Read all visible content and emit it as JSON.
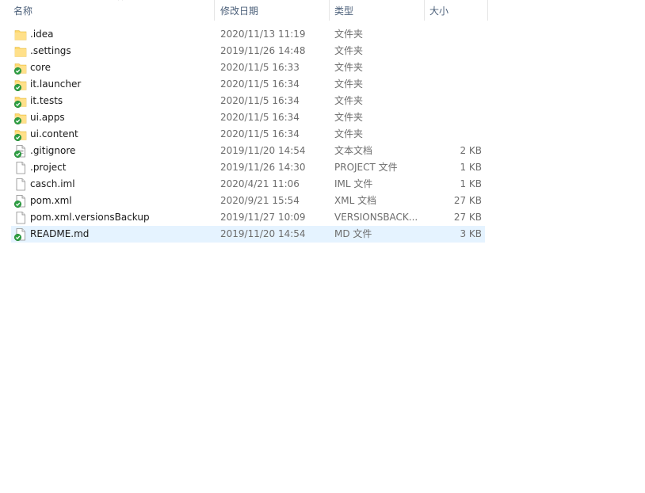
{
  "columns": {
    "name": "名称",
    "date": "修改日期",
    "type": "类型",
    "size": "大小"
  },
  "files": [
    {
      "name": ".idea",
      "date": "2020/11/13 11:19",
      "type": "文件夹",
      "size": "",
      "icon": "folder-icon",
      "badge": false
    },
    {
      "name": ".settings",
      "date": "2019/11/26 14:48",
      "type": "文件夹",
      "size": "",
      "icon": "folder-icon",
      "badge": false
    },
    {
      "name": "core",
      "date": "2020/11/5 16:33",
      "type": "文件夹",
      "size": "",
      "icon": "folder-icon",
      "badge": true
    },
    {
      "name": "it.launcher",
      "date": "2020/11/5 16:34",
      "type": "文件夹",
      "size": "",
      "icon": "folder-icon",
      "badge": true
    },
    {
      "name": "it.tests",
      "date": "2020/11/5 16:34",
      "type": "文件夹",
      "size": "",
      "icon": "folder-icon",
      "badge": true
    },
    {
      "name": "ui.apps",
      "date": "2020/11/5 16:34",
      "type": "文件夹",
      "size": "",
      "icon": "folder-icon",
      "badge": true
    },
    {
      "name": "ui.content",
      "date": "2020/11/5 16:34",
      "type": "文件夹",
      "size": "",
      "icon": "folder-icon",
      "badge": true
    },
    {
      "name": ".gitignore",
      "date": "2019/11/20 14:54",
      "type": "文本文档",
      "size": "2 KB",
      "icon": "text-file-icon",
      "badge": true
    },
    {
      "name": ".project",
      "date": "2019/11/26 14:30",
      "type": "PROJECT 文件",
      "size": "1 KB",
      "icon": "file-icon",
      "badge": false
    },
    {
      "name": "casch.iml",
      "date": "2020/4/21 11:06",
      "type": "IML 文件",
      "size": "1 KB",
      "icon": "file-icon",
      "badge": false
    },
    {
      "name": "pom.xml",
      "date": "2020/9/21 15:54",
      "type": "XML 文档",
      "size": "27 KB",
      "icon": "file-icon",
      "badge": true
    },
    {
      "name": "pom.xml.versionsBackup",
      "date": "2019/11/27 10:09",
      "type": "VERSIONSBACK...",
      "size": "27 KB",
      "icon": "file-icon",
      "badge": false
    },
    {
      "name": "README.md",
      "date": "2019/11/20 14:54",
      "type": "MD 文件",
      "size": "3 KB",
      "icon": "file-icon",
      "badge": true,
      "selected": true
    }
  ],
  "colors": {
    "selected_row": "#e5f3ff",
    "header_text": "#4c607a",
    "folder": "#ffd86b",
    "badge_green": "#2ea043"
  }
}
